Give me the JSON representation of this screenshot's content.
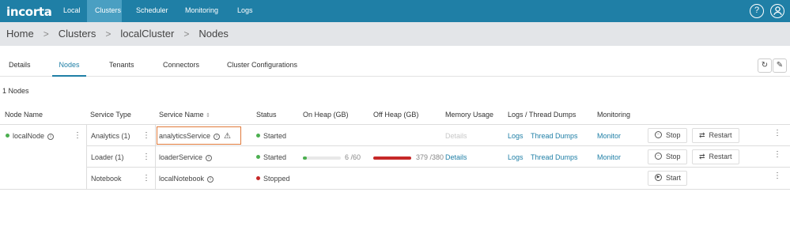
{
  "app": {
    "logo": "incorta",
    "nav": [
      "Local",
      "Clusters",
      "Scheduler",
      "Monitoring",
      "Logs"
    ],
    "active_nav": "Clusters",
    "help_icon": "help-circle-icon",
    "user_icon": "user-circle-icon"
  },
  "breadcrumb": [
    "Home",
    "Clusters",
    "localCluster",
    "Nodes"
  ],
  "tabs": [
    "Details",
    "Nodes",
    "Tenants",
    "Connectors",
    "Cluster Configurations"
  ],
  "active_tab": "Nodes",
  "toolbar": {
    "refresh_icon": "refresh-icon",
    "edit_icon": "edit-icon"
  },
  "node_count": "1 Nodes",
  "columns": [
    "Node Name",
    "Service Type",
    "Service Name",
    "Status",
    "On Heap (GB)",
    "Off Heap (GB)",
    "Memory Usage",
    "Logs / Thread Dumps",
    "Monitoring"
  ],
  "node": {
    "name": "localNode",
    "status_color": "#4caf50"
  },
  "services": [
    {
      "type": "Analytics (1)",
      "name": "analyticsService",
      "warning": true,
      "status": "Started",
      "status_color": "#4caf50",
      "on_heap_text": "",
      "on_heap_fraction": null,
      "off_heap_text": "",
      "off_heap_fraction": null,
      "memory_usage": "Details",
      "memory_usage_enabled": false,
      "logs": "Logs",
      "thread_dumps": "Thread Dumps",
      "monitoring": "Monitor",
      "action": "Stop",
      "restart": "Restart"
    },
    {
      "type": "Loader (1)",
      "name": "loaderService",
      "warning": false,
      "status": "Started",
      "status_color": "#4caf50",
      "on_heap_text": "6 /60",
      "on_heap_fraction": 0.1,
      "off_heap_text": "379 /380",
      "off_heap_fraction": 0.997,
      "memory_usage": "Details",
      "memory_usage_enabled": true,
      "logs": "Logs",
      "thread_dumps": "Thread Dumps",
      "monitoring": "Monitor",
      "action": "Stop",
      "restart": "Restart"
    },
    {
      "type": "Notebook",
      "name": "localNotebook",
      "warning": false,
      "status": "Stopped",
      "status_color": "#c62828",
      "on_heap_text": "",
      "on_heap_fraction": null,
      "off_heap_text": "",
      "off_heap_fraction": null,
      "memory_usage": "",
      "memory_usage_enabled": false,
      "logs": "",
      "thread_dumps": "",
      "monitoring": "",
      "action": "Start",
      "restart": ""
    }
  ],
  "colors": {
    "primary": "#1f7fa6",
    "on_heap_bar": "#4caf50",
    "off_heap_bar": "#c62828"
  }
}
